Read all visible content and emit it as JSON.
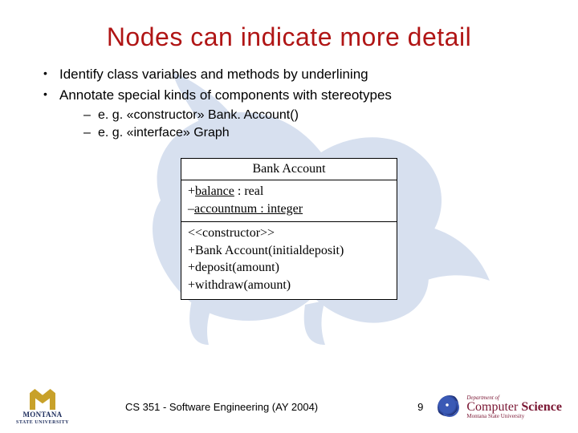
{
  "title": "Nodes can indicate more detail",
  "bullets": {
    "b1": "Identify class variables and methods by underlining",
    "b2": "Annotate special kinds of components with stereotypes",
    "s1": "e. g. «constructor» Bank. Account()",
    "s2": "e. g. «interface» Graph"
  },
  "uml": {
    "class_name": "Bank Account",
    "attr1_pre": "+",
    "attr1_ul": "balance",
    "attr1_post": " : real",
    "attr2_pre": "–",
    "attr2_ul": "accountnum : integer",
    "op_stereo": "<<constructor>>",
    "op1": "+Bank Account(initialdeposit)",
    "op2": "+deposit(amount)",
    "op3": "+withdraw(amount)"
  },
  "footer": {
    "msu": "MONTANA",
    "msu_sub": "STATE UNIVERSITY",
    "center": "CS 351 - Software Engineering (AY 2004)",
    "num": "9",
    "cs_dept": "Department of",
    "cs_name_a": "Computer ",
    "cs_name_b": "Science",
    "cs_univ": "Montana State University"
  }
}
